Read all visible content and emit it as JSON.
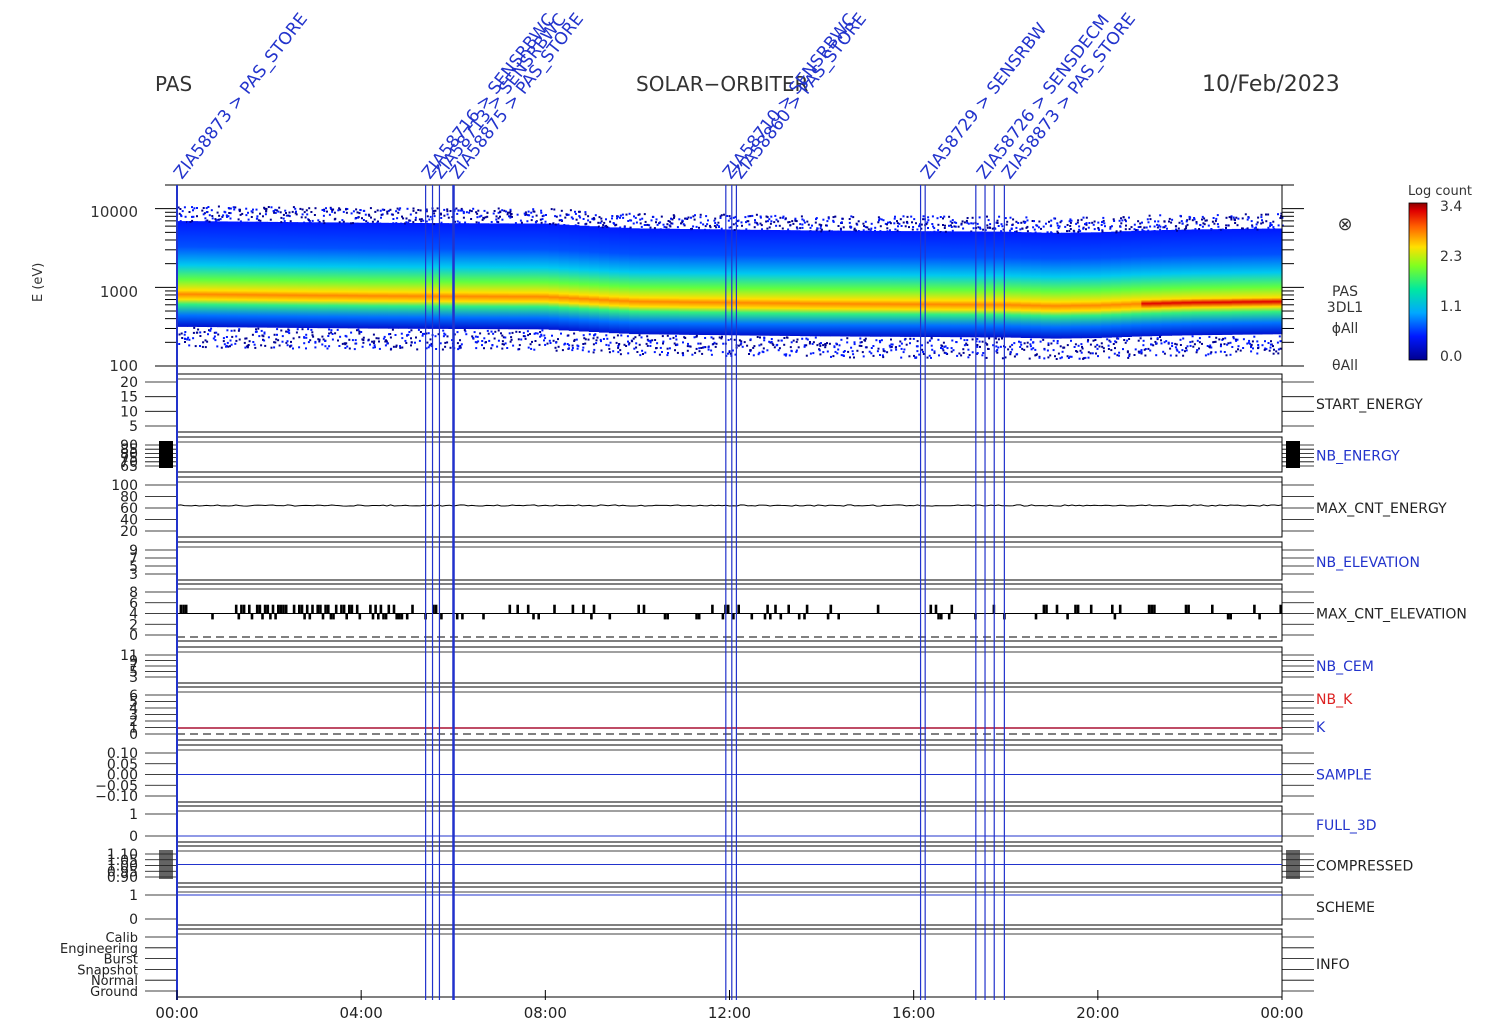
{
  "header": {
    "instrument": "PAS",
    "mission": "SOLAR−ORBITER",
    "date": "10/Feb/2023"
  },
  "annotations": [
    "ZIA58873 > PAS_STORE",
    "ZIA58716 > SENSRBWC",
    "ZIA58713 > SENSRBWC",
    "ZIA58875 > PAS_STORE",
    "ZIA58860 > PAS_STORE",
    "ZIA58710 > SENSRBWC",
    "ZIA58729 > SENSRBW",
    "ZIA58726 > SENSDECM",
    "ZIA58873 > PAS_STORE"
  ],
  "colors": {
    "annotation": "#2233cc",
    "panel_line": "#000000",
    "nb_k_label": "#dd2222",
    "k_line": "#aa1133",
    "sample_line": "#2233cc",
    "colorbar_low": "#000090",
    "colorbar_high": "#8b0000"
  },
  "chart_data": {
    "type": "spectrogram_stack",
    "time_axis": {
      "ticks": [
        "00:00",
        "04:00",
        "08:00",
        "12:00",
        "16:00",
        "20:00",
        "00:00"
      ],
      "range_hours": [
        0,
        24
      ]
    },
    "spectrogram": {
      "ylabel": "E (eV)",
      "yscale": "log",
      "ylim": [
        100,
        20000
      ],
      "yticks": [
        "10000",
        "1000",
        "100"
      ],
      "labels": [
        "PAS",
        "3DL1",
        "ϕAll",
        "θAll"
      ],
      "symbol": "⊗",
      "colorbar": {
        "label": "Log count",
        "ticks": [
          "3.4",
          "2.3",
          "1.1",
          "0.0"
        ],
        "range": [
          0.0,
          3.4
        ]
      },
      "peak_energy_ev": {
        "hours": [
          0,
          2,
          4,
          6,
          8,
          9.5,
          10,
          12,
          14,
          16,
          18,
          19,
          20,
          21,
          22,
          23,
          24
        ],
        "values": [
          820,
          800,
          780,
          770,
          760,
          680,
          660,
          640,
          620,
          610,
          600,
          580,
          590,
          620,
          640,
          650,
          660
        ]
      }
    },
    "panels": [
      {
        "label": "START_ENERGY",
        "ticks": [
          "20",
          "15",
          "10",
          "5"
        ]
      },
      {
        "label": "NB_ENERGY",
        "ticks": [
          "90",
          "85",
          "80",
          "75",
          "70",
          "65"
        ]
      },
      {
        "label": "MAX_CNT_ENERGY",
        "ticks": [
          "100",
          "80",
          "60",
          "40",
          "20"
        ],
        "value": 55
      },
      {
        "label": "NB_ELEVATION",
        "ticks": [
          "9",
          "7",
          "5",
          "3"
        ]
      },
      {
        "label": "MAX_CNT_ELEVATION",
        "ticks": [
          "8",
          "6",
          "4",
          "2",
          "0"
        ],
        "typical": 4,
        "high": 5.5
      },
      {
        "label": "NB_CEM",
        "ticks": [
          "11",
          "9",
          "7",
          "5",
          "3"
        ]
      },
      {
        "label": "NB_K",
        "ticks": [
          "6",
          "5",
          "4",
          "3",
          "2",
          "1",
          "0"
        ],
        "extra_label": "K",
        "value": 1
      },
      {
        "label": "SAMPLE",
        "ticks": [
          "0.10",
          "0.05",
          "0.00",
          "−0.05",
          "−0.10"
        ],
        "value": 0.0
      },
      {
        "label": "FULL_3D",
        "ticks": [
          "1",
          "0"
        ],
        "value": 0
      },
      {
        "label": "COMPRESSED",
        "ticks": [
          "1.10",
          "1.05",
          "1.00",
          "0.95",
          "0.90"
        ],
        "value": 1.0
      },
      {
        "label": "SCHEME",
        "ticks": [
          "1",
          "0"
        ],
        "value": 1
      },
      {
        "label": "INFO",
        "ticks": [
          "Calib",
          "Engineering",
          "Burst",
          "Snapshot",
          "Normal",
          "Ground"
        ]
      }
    ]
  }
}
